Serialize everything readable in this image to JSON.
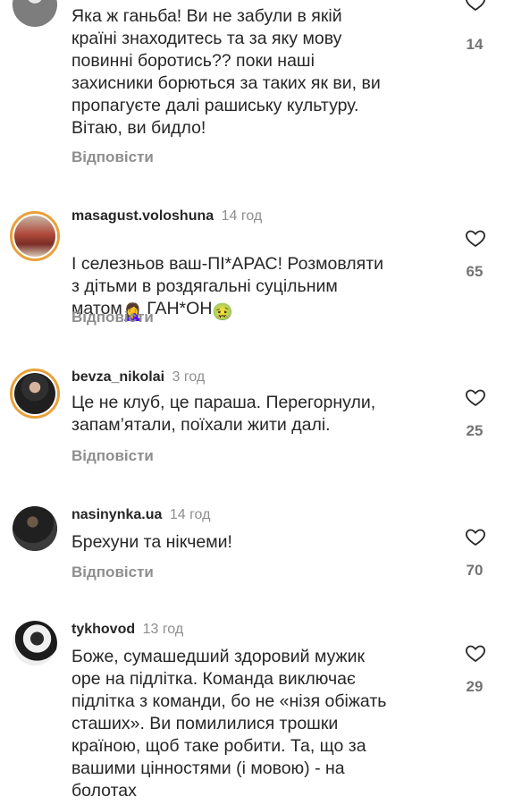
{
  "reply_label": "Відповісти",
  "comments": [
    {
      "username": "",
      "time": "",
      "text": "Яка ж ганьба! Ви не забули в якій\nкраїні знаходитесь та за яку мову\nповинні боротись?? поки наші\nзахисники борються за таких як ви, ви\nпропагуєте далі рашиську культуру.\nВітаю, ви бидло!",
      "likes": "14"
    },
    {
      "username": "masagust.voloshuna",
      "time": "14 год",
      "text_main": "І селезньов ваш-ПІ*АРАС! Розмовляти\nз дітьми в роздягальні суцільним\nматом",
      "emoji_1": "🤦‍♀️",
      "text_after": "ГАН*ОН",
      "emoji_2": "🤢",
      "likes": "65"
    },
    {
      "username": "bevza_nikolai",
      "time": "3 год",
      "text": "Це не клуб, це параша. Перегорнули,\nзапам’ятали, поїхали жити далі.",
      "likes": "25"
    },
    {
      "username": "nasinynka.ua",
      "time": "14 год",
      "text": "Брехуни та нікчеми!",
      "likes": "70"
    },
    {
      "username": "tykhovod",
      "time": "13 год",
      "text": "Боже, сумашедший здоровий мужик\nоре на підлітка. Команда виключає\nпідлітка з команди, бо не «нізя обіжать\nсташих». Ви помилилися трошки\nкраїною, щоб таке робити. Та, що за\nвашими цінностями (і мовою) - на\nболотах",
      "likes": "29"
    }
  ],
  "colors": {
    "text": "#262626",
    "muted": "#8e8e8e",
    "likes": "#737373",
    "story_ring": "#e8a13a"
  },
  "icons": {
    "like": "heart-outline-icon"
  }
}
